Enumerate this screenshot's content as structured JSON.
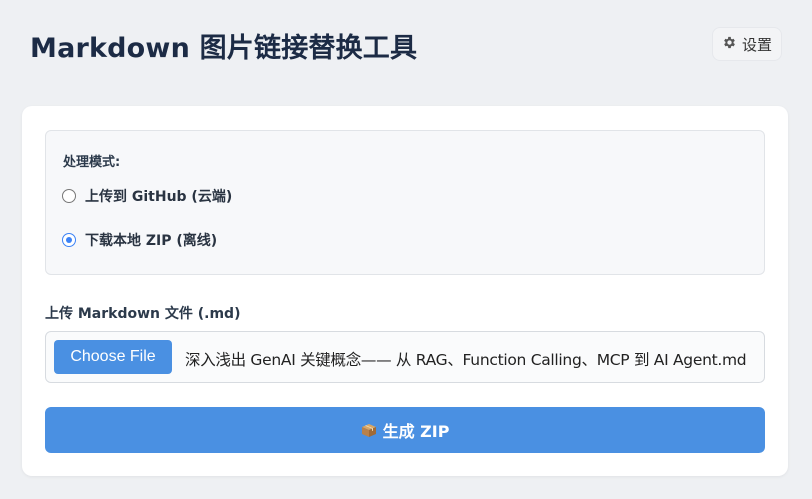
{
  "header": {
    "title": "Markdown 图片链接替换工具",
    "settings_label": "设置",
    "settings_icon": "gear-icon"
  },
  "mode": {
    "label": "处理模式:",
    "options": [
      {
        "label": "上传到 GitHub (云端)",
        "checked": false
      },
      {
        "label": "下载本地 ZIP (离线)",
        "checked": true
      }
    ]
  },
  "upload": {
    "label": "上传 Markdown 文件 (.md)",
    "choose_button": "Choose File",
    "file_name": "深入浅出 GenAI 关键概念—— 从 RAG、Function Calling、MCP 到 AI Agent.md"
  },
  "generate": {
    "label": "生成 ZIP",
    "icon": "package-icon"
  },
  "colors": {
    "accent": "#4a90e2",
    "background": "#eef0f3",
    "title": "#1c2b45"
  }
}
